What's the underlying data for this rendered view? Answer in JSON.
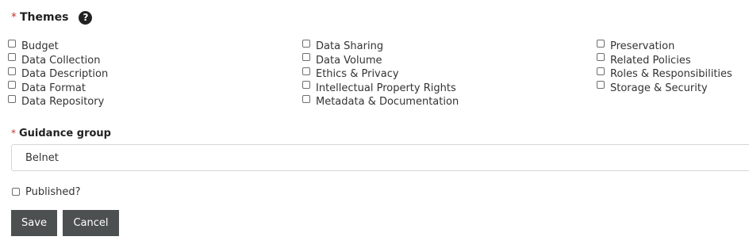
{
  "themes": {
    "required_marker": "*",
    "label": "Themes",
    "help_icon": "question-circle-icon",
    "columns": [
      [
        "Budget",
        "Data Collection",
        "Data Description",
        "Data Format",
        "Data Repository"
      ],
      [
        "Data Sharing",
        "Data Volume",
        "Ethics & Privacy",
        "Intellectual Property Rights",
        "Metadata & Documentation"
      ],
      [
        "Preservation",
        "Related Policies",
        "Roles & Responsibilities",
        "Storage & Security"
      ]
    ]
  },
  "guidance_group": {
    "required_marker": "*",
    "label": "Guidance group",
    "selected_value": "Belnet"
  },
  "published": {
    "label": "Published?",
    "checked": false
  },
  "buttons": {
    "save_label": "Save",
    "cancel_label": "Cancel"
  },
  "colors": {
    "required": "#c0392b",
    "button_bg": "#4d5051",
    "text": "#333333"
  }
}
